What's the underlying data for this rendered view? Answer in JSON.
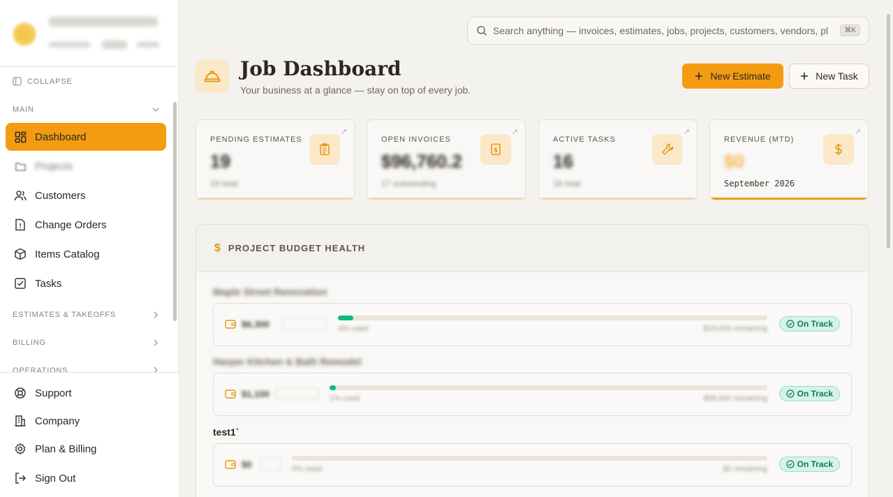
{
  "sidebar": {
    "collapse_label": "COLLAPSE",
    "sections": {
      "main": "MAIN",
      "estimates": "ESTIMATES & TAKEOFFS",
      "billing": "BILLING",
      "operations": "OPERATIONS"
    },
    "items": [
      {
        "label": "Dashboard",
        "icon": "dashboard-grid-icon",
        "active": true
      },
      {
        "label": "Projects",
        "icon": "folder-chart-icon",
        "active": false
      },
      {
        "label": "Customers",
        "icon": "users-icon",
        "active": false
      },
      {
        "label": "Change Orders",
        "icon": "document-alert-icon",
        "active": false
      },
      {
        "label": "Items Catalog",
        "icon": "package-icon",
        "active": false
      },
      {
        "label": "Tasks",
        "icon": "checkbox-icon",
        "active": false
      }
    ],
    "bottom": [
      {
        "label": "Support",
        "icon": "lifebuoy-icon"
      },
      {
        "label": "Company",
        "icon": "building-icon"
      },
      {
        "label": "Plan & Billing",
        "icon": "gear-icon"
      },
      {
        "label": "Sign Out",
        "icon": "sign-out-icon"
      }
    ]
  },
  "search": {
    "placeholder": "Search anything — invoices, estimates, jobs, projects, customers, vendors, pl",
    "shortcut": "⌘K"
  },
  "header": {
    "title": "Job Dashboard",
    "subtitle": "Your business at a glance — stay on top of every job.",
    "new_estimate": "New Estimate",
    "new_task": "New Task"
  },
  "stats": [
    {
      "label": "PENDING ESTIMATES",
      "value": "19",
      "sub": "19 total"
    },
    {
      "label": "OPEN INVOICES",
      "value": "$96,760.2",
      "sub": "17 outstanding"
    },
    {
      "label": "ACTIVE TASKS",
      "value": "16",
      "sub": "16 total"
    },
    {
      "label": "REVENUE (MTD)",
      "value": "$0",
      "sub": "September 2026"
    }
  ],
  "budget": {
    "title": "PROJECT BUDGET HEALTH",
    "projects": [
      {
        "name": "Maple Street Renovation",
        "amount": "$6,300",
        "progress": 0.035,
        "pct": "4% used",
        "remaining": "$19,000 remaining",
        "status": "On Track"
      },
      {
        "name": "Harper Kitchen & Bath Remodel",
        "amount": "$1,100",
        "progress": 0.015,
        "pct": "1% used",
        "remaining": "$98,000 remaining",
        "status": "On Track"
      },
      {
        "name": "test1`",
        "amount": "$0",
        "progress": 0.0,
        "pct": "0% used",
        "remaining": "$0 remaining",
        "status": "On Track"
      }
    ]
  },
  "colors": {
    "accent": "#f39c12",
    "success": "#10b981",
    "badge_bg": "#d5f3e6"
  }
}
